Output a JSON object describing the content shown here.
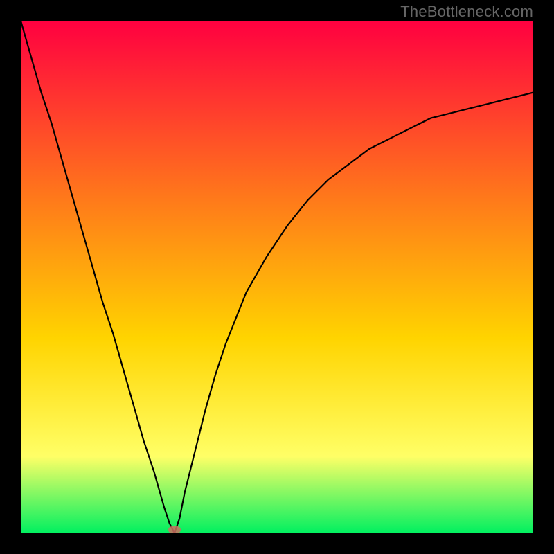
{
  "watermark": "TheBottleneck.com",
  "colors": {
    "top": "#ff0040",
    "mid_upper": "#ff7a1a",
    "mid": "#ffd400",
    "mid_lower": "#ffff66",
    "bottom": "#00f060",
    "curve": "#000000",
    "marker": "#cc6f60",
    "frame": "#000000"
  },
  "chart_data": {
    "type": "line",
    "title": "",
    "xlabel": "",
    "ylabel": "",
    "xlim": [
      0,
      100
    ],
    "ylim": [
      0,
      100
    ],
    "x": [
      0,
      2,
      4,
      6,
      8,
      10,
      12,
      14,
      16,
      18,
      20,
      22,
      24,
      26,
      28,
      29,
      30,
      31,
      32,
      34,
      36,
      38,
      40,
      44,
      48,
      52,
      56,
      60,
      64,
      68,
      72,
      76,
      80,
      84,
      88,
      92,
      96,
      100
    ],
    "y": [
      100,
      93,
      86,
      80,
      73,
      66,
      59,
      52,
      45,
      39,
      32,
      25,
      18,
      12,
      5,
      2,
      0,
      3,
      8,
      16,
      24,
      31,
      37,
      47,
      54,
      60,
      65,
      69,
      72,
      75,
      77,
      79,
      81,
      82,
      83,
      84,
      85,
      86
    ],
    "marker": {
      "x": 30,
      "y": 0.7
    },
    "annotations": []
  }
}
